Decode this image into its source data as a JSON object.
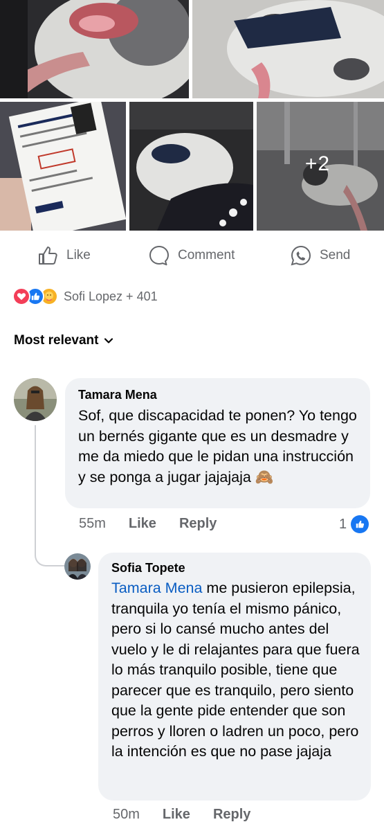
{
  "post": {
    "photos_more": "+2",
    "actions": {
      "like": "Like",
      "comment": "Comment",
      "send": "Send"
    },
    "reactions": {
      "types": [
        "love",
        "like",
        "care"
      ],
      "summary": "Sofi Lopez + 401"
    },
    "sort_label": "Most relevant"
  },
  "comments": [
    {
      "author": "Tamara Mena",
      "text": "Sof, que discapacidad te ponen? Yo tengo un bernés gigante que es un desmadre y me da miedo que le pidan una instrucción y se ponga a jugar jajajaja 🙈",
      "time": "55m",
      "like_label": "Like",
      "reply_label": "Reply",
      "like_count": "1"
    },
    {
      "author": "Sofia Topete",
      "mention": "Tamara Mena",
      "text": " me pusieron epilepsia, tranquila yo tenía el mismo pánico, pero si lo cansé mucho antes del vuelo y le di relajantes para que fuera lo más tranquilo posible, tiene que parecer que es tranquilo, pero siento que la gente pide entender que son perros y lloren o ladren un poco, pero la intención es que no pase jajaja",
      "time": "50m",
      "like_label": "Like",
      "reply_label": "Reply"
    }
  ],
  "colors": {
    "accent": "#1877f2",
    "mention": "#0a5dc2",
    "bubble": "#f0f2f5",
    "muted": "#65676b"
  }
}
